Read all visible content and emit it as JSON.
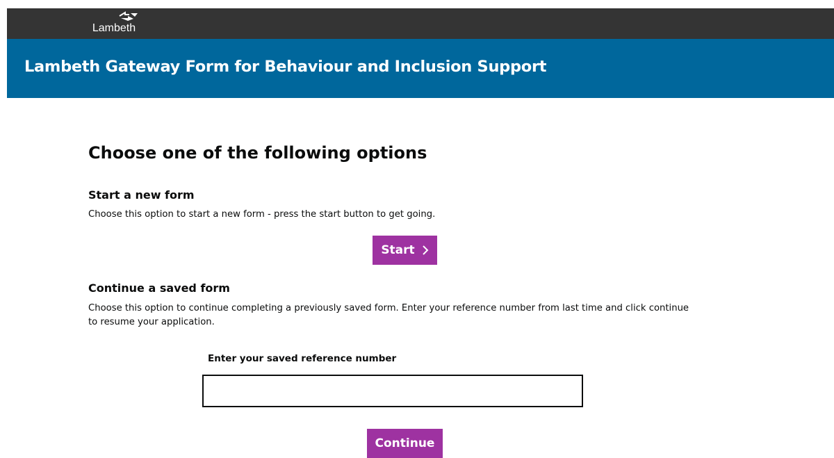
{
  "header": {
    "logo_text": "Lambeth",
    "banner_title": "Lambeth Gateway Form for Behaviour and Inclusion Support"
  },
  "main": {
    "title": "Choose one of the following options",
    "new_form": {
      "heading": "Start a new form",
      "description": "Choose this option to start a new form - press the start button to get going.",
      "button_label": "Start"
    },
    "saved_form": {
      "heading": "Continue a saved form",
      "description": "Choose this option to continue completing a previously saved form. Enter your reference number from last time and click continue to resume your application.",
      "input_label": "Enter your saved reference number",
      "input_value": "",
      "button_label": "Continue"
    }
  },
  "colors": {
    "topbar": "#343434",
    "banner": "#00679c",
    "button": "#9e32a1"
  },
  "icons": {
    "logo": "lambeth-logo-icon",
    "start_chevron": "chevron-right-icon"
  }
}
